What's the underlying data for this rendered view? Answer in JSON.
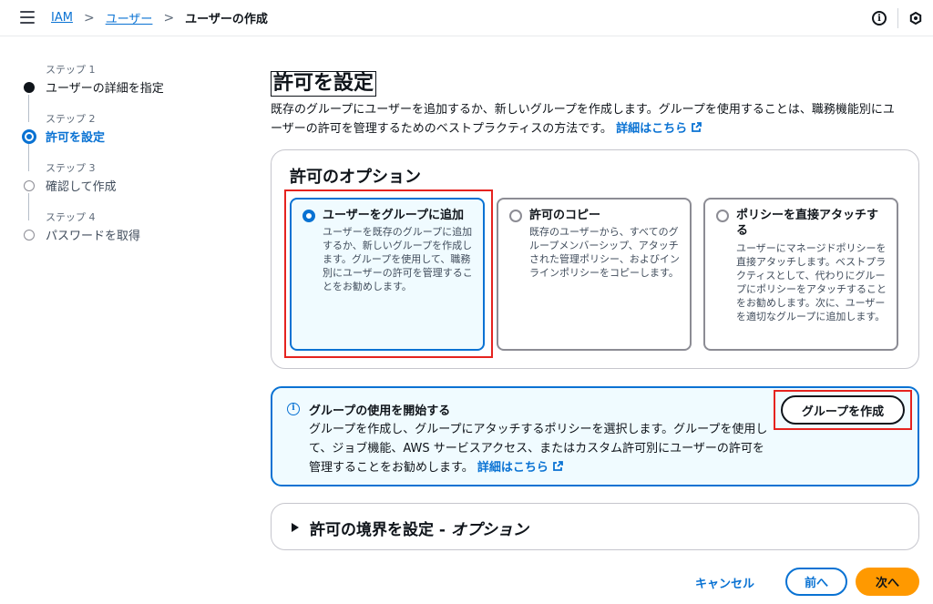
{
  "breadcrumb": {
    "items": [
      "IAM",
      "ユーザー"
    ],
    "current": "ユーザーの作成",
    "separator": ">"
  },
  "top_icons": [
    "info-icon",
    "settings-icon"
  ],
  "steps": [
    {
      "num": "ステップ 1",
      "title": "ユーザーの詳細を指定",
      "state": "done"
    },
    {
      "num": "ステップ 2",
      "title": "許可を設定",
      "state": "active"
    },
    {
      "num": "ステップ 3",
      "title": "確認して作成",
      "state": "todo"
    },
    {
      "num": "ステップ 4",
      "title": "パスワードを取得",
      "state": "todo"
    }
  ],
  "main": {
    "title": "許可を設定",
    "description_line1": "既存のグループにユーザーを追加するか、新しいグループを作成します。グループを使用することは、職務機能別にユ",
    "description_line2": "ーザーの許可を管理するためのベストプラクティスの方法です。",
    "learn_more": "詳細はこちら"
  },
  "options": {
    "title": "許可のオプション",
    "tiles": [
      {
        "label": "ユーザーをグループに追加",
        "desc": "ユーザーを既存のグループに追加するか、新しいグループを作成します。グループを使用して、職務別にユーザーの許可を管理することをお勧めします。",
        "selected": true
      },
      {
        "label": "許可のコピー",
        "desc": "既存のユーザーから、すべてのグループメンバーシップ、アタッチされた管理ポリシー、およびインラインポリシーをコピーします。",
        "selected": false
      },
      {
        "label": "ポリシーを直接アタッチする",
        "desc": "ユーザーにマネージドポリシーを直接アタッチします。ベストプラクティスとして、代わりにグループにポリシーをアタッチすることをお勧めします。次に、ユーザーを適切なグループに追加します。",
        "selected": false
      }
    ]
  },
  "info": {
    "title": "グループの使用を開始する",
    "body": "グループを作成し、グループにアタッチするポリシーを選択します。グループを使用して、ジョブ機能、AWS サービスアクセス、またはカスタム許可別にユーザーの許可を管理することをお勧めします。",
    "learn_more": "詳細はこちら",
    "button": "グループを作成"
  },
  "boundary": {
    "title": "許可の境界を設定 - ",
    "title_italic": "オプション"
  },
  "footer": {
    "cancel": "キャンセル",
    "prev": "前へ",
    "next": "次へ"
  },
  "colors": {
    "link": "#0972d3",
    "primary_button": "#ff9900",
    "annotation": "#e5231f"
  }
}
